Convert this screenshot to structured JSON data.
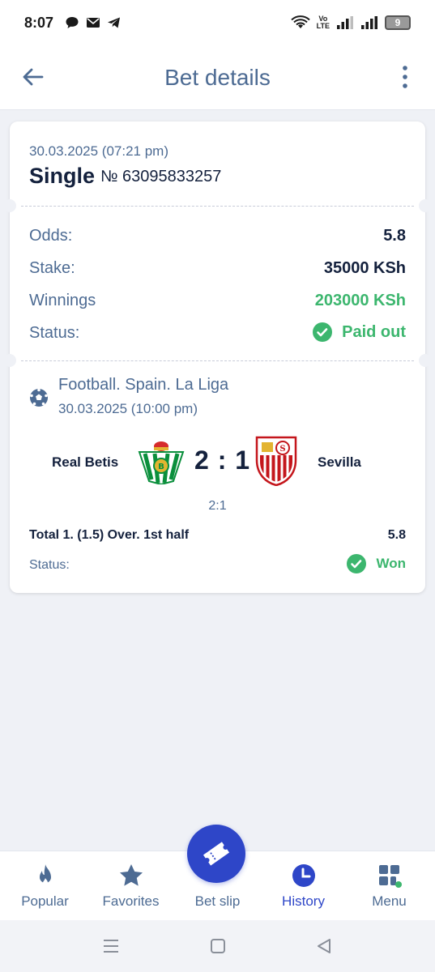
{
  "status_bar": {
    "time": "8:07",
    "network_label_top": "Vo",
    "network_label_bottom": "LTE",
    "battery": "9"
  },
  "header": {
    "title": "Bet details"
  },
  "bet": {
    "date": "30.03.2025 (07:21 pm)",
    "type": "Single",
    "number": "№ 63095833257",
    "rows": {
      "odds_label": "Odds:",
      "odds_value": "5.8",
      "stake_label": "Stake:",
      "stake_value": "35000 KSh",
      "winnings_label": "Winnings",
      "winnings_value": "203000 KSh",
      "status_label": "Status:",
      "status_value": "Paid out"
    }
  },
  "event": {
    "league": "Football. Spain. La Liga",
    "date": "30.03.2025 (10:00 pm)",
    "home_team": "Real Betis",
    "away_team": "Sevilla",
    "score": "2 : 1",
    "half_time_score": "2:1",
    "market": "Total 1. (1.5) Over. 1st half",
    "market_odds": "5.8",
    "status_label": "Status:",
    "status_value": "Won"
  },
  "bottom_nav": {
    "popular": "Popular",
    "favorites": "Favorites",
    "bet_slip": "Bet slip",
    "history": "History",
    "menu": "Menu"
  },
  "colors": {
    "accent": "#2e46c8",
    "text_muted": "#4d6b93",
    "text_dark": "#14213d",
    "success": "#3cb66e",
    "background": "#eff1f6"
  }
}
